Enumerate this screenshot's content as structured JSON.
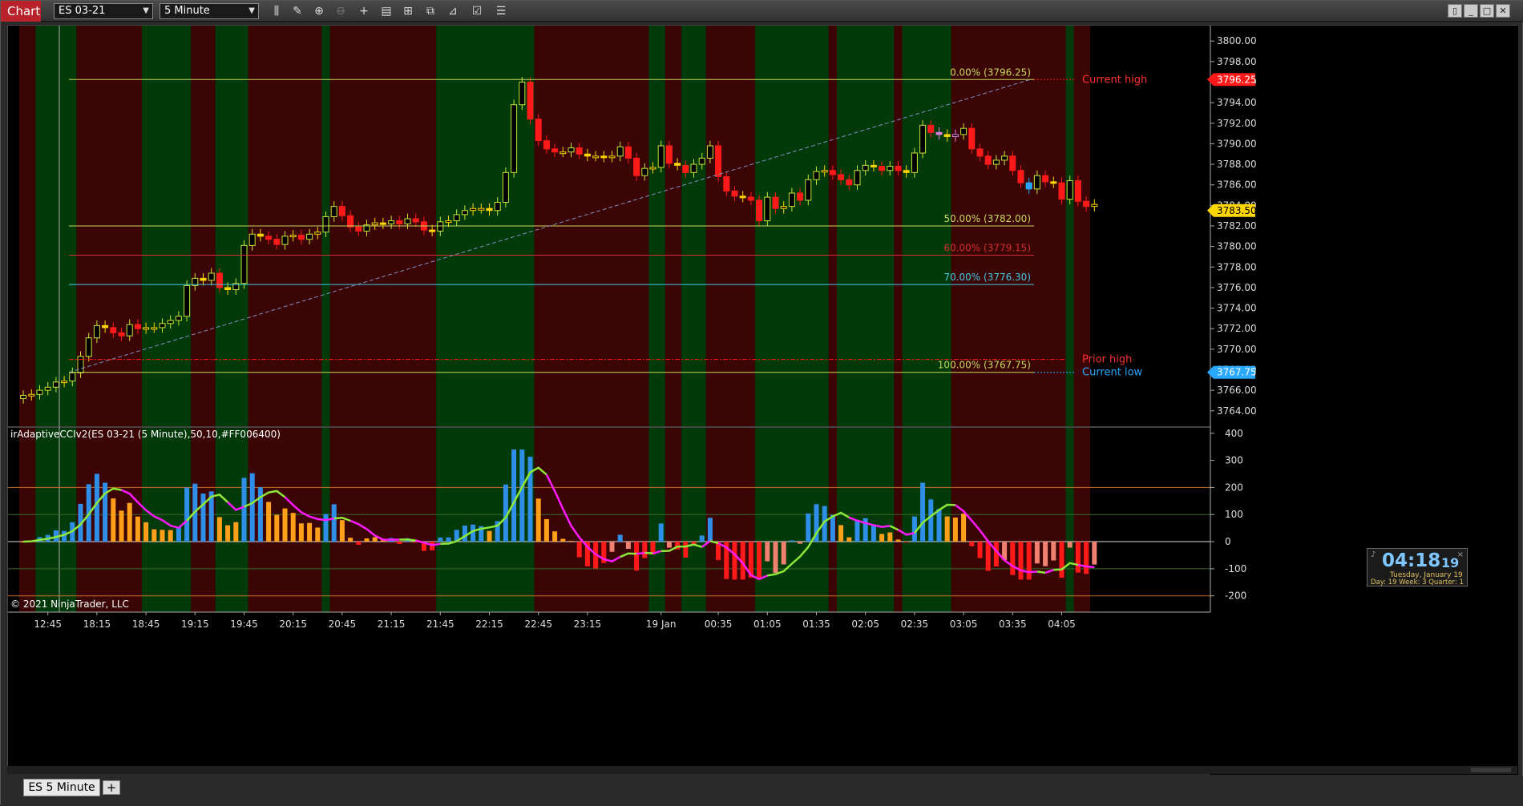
{
  "toolbar": {
    "chart_label": "Chart",
    "instrument": "ES 03-21",
    "interval": "5 Minute"
  },
  "tabs": {
    "active": "ES  5 Minute",
    "add": "+"
  },
  "price_axis": {
    "ticks": [
      "3800.00",
      "3798.00",
      "3796.00",
      "3794.00",
      "3792.00",
      "3790.00",
      "3788.00",
      "3786.00",
      "3784.00",
      "3782.00",
      "3780.00",
      "3778.00",
      "3776.00",
      "3774.00",
      "3772.00",
      "3770.00",
      "3768.00",
      "3766.00",
      "3764.00"
    ],
    "tick_values": [
      3800,
      3798,
      3796,
      3794,
      3792,
      3790,
      3788,
      3786,
      3784,
      3782,
      3780,
      3778,
      3776,
      3774,
      3772,
      3770,
      3768,
      3766,
      3764
    ],
    "range": [
      3762.5,
      3801.5
    ],
    "current_high": {
      "label": "3796.25",
      "value": 3796.25,
      "color": "#ff1a1a"
    },
    "last_price": {
      "label": "3783.50",
      "value": 3783.5,
      "color": "#ffd700"
    },
    "current_low": {
      "label": "3767.75",
      "value": 3767.75,
      "color": "#29a8ff"
    }
  },
  "fib_levels": [
    {
      "label": "0.00% (3796.25)",
      "value": 3796.25,
      "color": "#c8d85a"
    },
    {
      "label": "50.00% (3782.00)",
      "value": 3782.0,
      "color": "#c8d85a"
    },
    {
      "label": "60.00% (3779.15)",
      "value": 3779.15,
      "color": "#d23030"
    },
    {
      "label": "70.00% (3776.30)",
      "value": 3776.3,
      "color": "#40c8e8"
    },
    {
      "label": "100.00% (3767.75)",
      "value": 3767.75,
      "color": "#c8d85a"
    }
  ],
  "side_labels": {
    "current_high": "Current high",
    "prior_high": "Prior high",
    "current_low": "Current low",
    "prior_high_value": 3769.0
  },
  "indicator": {
    "title": "irAdaptiveCCIv2(ES 03-21 (5 Minute),50,10,#FF006400)",
    "ticks": [
      "400",
      "300",
      "200",
      "100",
      "0",
      "-100",
      "-200"
    ],
    "tick_values": [
      400,
      300,
      200,
      100,
      0,
      -100,
      -200
    ],
    "range": [
      -260,
      420
    ],
    "level_lines": [
      200,
      100,
      0,
      -100,
      -200
    ]
  },
  "time_axis": {
    "labels": [
      "12:45",
      "18:15",
      "18:45",
      "19:15",
      "19:45",
      "20:15",
      "20:45",
      "21:15",
      "21:45",
      "22:15",
      "22:45",
      "23:15",
      "19 Jan",
      "00:35",
      "01:05",
      "01:35",
      "02:05",
      "02:35",
      "03:05",
      "03:35",
      "04:05"
    ],
    "label_bars": [
      3,
      9,
      15,
      21,
      27,
      33,
      39,
      45,
      51,
      57,
      63,
      69,
      78,
      85,
      91,
      97,
      103,
      109,
      115,
      121,
      127
    ]
  },
  "copyright": "© 2021 NinjaTrader, LLC",
  "clock": {
    "time": "04:18",
    "seconds": "19",
    "date": "Tuesday, January 19",
    "info": "Day: 19    Week: 3    Quarter: 1"
  },
  "colors": {
    "up_green": "#033a0a",
    "down_red": "#3c0505",
    "candle_up": "#c6e53a",
    "candle_down": "#ff1a1a",
    "candle_gold": "#ffd700",
    "candle_pink": "#e080e0",
    "candle_cyan": "#29a8ff",
    "hist_blue": "#2f8fe8",
    "hist_orange": "#ff9f1a",
    "hist_salmon": "#f08070",
    "hist_red": "#ff1a1a",
    "cci_green": "#8ee83a",
    "cci_magenta": "#ff1aff"
  },
  "chart_data": {
    "type": "candlestick",
    "x": [
      "12:45",
      "18:15",
      "18:45",
      "19:15",
      "19:45",
      "20:15",
      "20:45",
      "21:15",
      "21:45",
      "22:15",
      "22:45",
      "23:15",
      "19 Jan",
      "00:35",
      "01:05",
      "01:35",
      "02:05",
      "02:35",
      "03:05",
      "03:35",
      "04:05"
    ],
    "background_bands": [
      {
        "from": 0,
        "to": 2,
        "trend": "down"
      },
      {
        "from": 2,
        "to": 7,
        "trend": "up"
      },
      {
        "from": 7,
        "to": 15,
        "trend": "down"
      },
      {
        "from": 15,
        "to": 21,
        "trend": "up"
      },
      {
        "from": 21,
        "to": 24,
        "trend": "down"
      },
      {
        "from": 24,
        "to": 28,
        "trend": "up"
      },
      {
        "from": 28,
        "to": 37,
        "trend": "down"
      },
      {
        "from": 37,
        "to": 38,
        "trend": "up"
      },
      {
        "from": 38,
        "to": 51,
        "trend": "down"
      },
      {
        "from": 51,
        "to": 63,
        "trend": "up"
      },
      {
        "from": 63,
        "to": 77,
        "trend": "down"
      },
      {
        "from": 77,
        "to": 79,
        "trend": "up"
      },
      {
        "from": 79,
        "to": 81,
        "trend": "down"
      },
      {
        "from": 81,
        "to": 84,
        "trend": "up"
      },
      {
        "from": 84,
        "to": 90,
        "trend": "down"
      },
      {
        "from": 90,
        "to": 99,
        "trend": "up"
      },
      {
        "from": 99,
        "to": 100,
        "trend": "down"
      },
      {
        "from": 100,
        "to": 107,
        "trend": "up"
      },
      {
        "from": 107,
        "to": 108,
        "trend": "down"
      },
      {
        "from": 108,
        "to": 114,
        "trend": "up"
      },
      {
        "from": 114,
        "to": 128,
        "trend": "down"
      },
      {
        "from": 128,
        "to": 129,
        "trend": "up"
      },
      {
        "from": 129,
        "to": 131,
        "trend": "down"
      }
    ],
    "close": [
      3765.5,
      3765.6,
      3766.0,
      3766.3,
      3766.8,
      3766.9,
      3767.7,
      3769.3,
      3771.1,
      3772.3,
      3772.1,
      3771.6,
      3771.3,
      3772.4,
      3772.0,
      3772.1,
      3772.1,
      3772.5,
      3772.8,
      3773.2,
      3776.2,
      3776.9,
      3776.7,
      3777.4,
      3776.0,
      3775.8,
      3776.4,
      3780.1,
      3781.2,
      3781.0,
      3780.7,
      3780.2,
      3781.0,
      3781.1,
      3780.7,
      3781.2,
      3781.4,
      3782.9,
      3783.9,
      3783.0,
      3781.9,
      3781.5,
      3782.1,
      3782.3,
      3782.2,
      3782.5,
      3782.2,
      3782.7,
      3782.4,
      3781.6,
      3781.5,
      3782.4,
      3782.5,
      3783.1,
      3783.5,
      3783.7,
      3783.7,
      3783.5,
      3784.3,
      3787.2,
      3793.8,
      3796.0,
      3792.4,
      3790.3,
      3789.5,
      3789.2,
      3789.2,
      3789.6,
      3789.0,
      3788.8,
      3788.8,
      3788.7,
      3788.8,
      3789.7,
      3788.6,
      3786.9,
      3787.6,
      3787.7,
      3789.8,
      3788.1,
      3787.9,
      3787.2,
      3788.0,
      3788.6,
      3789.8,
      3786.8,
      3785.4,
      3784.9,
      3784.8,
      3784.5,
      3782.5,
      3784.8,
      3783.7,
      3783.9,
      3785.2,
      3784.5,
      3786.5,
      3787.3,
      3787.4,
      3787.0,
      3786.5,
      3786.0,
      3787.4,
      3787.9,
      3787.8,
      3787.4,
      3787.8,
      3787.4,
      3787.2,
      3789.1,
      3791.8,
      3791.1,
      3790.9,
      3790.7,
      3790.9,
      3791.5,
      3789.5,
      3788.8,
      3788.0,
      3788.4,
      3788.8,
      3787.4,
      3786.2,
      3785.6,
      3786.9,
      3786.3,
      3786.2,
      3784.6,
      3786.4,
      3784.4,
      3783.9,
      3784.1
    ]
  }
}
